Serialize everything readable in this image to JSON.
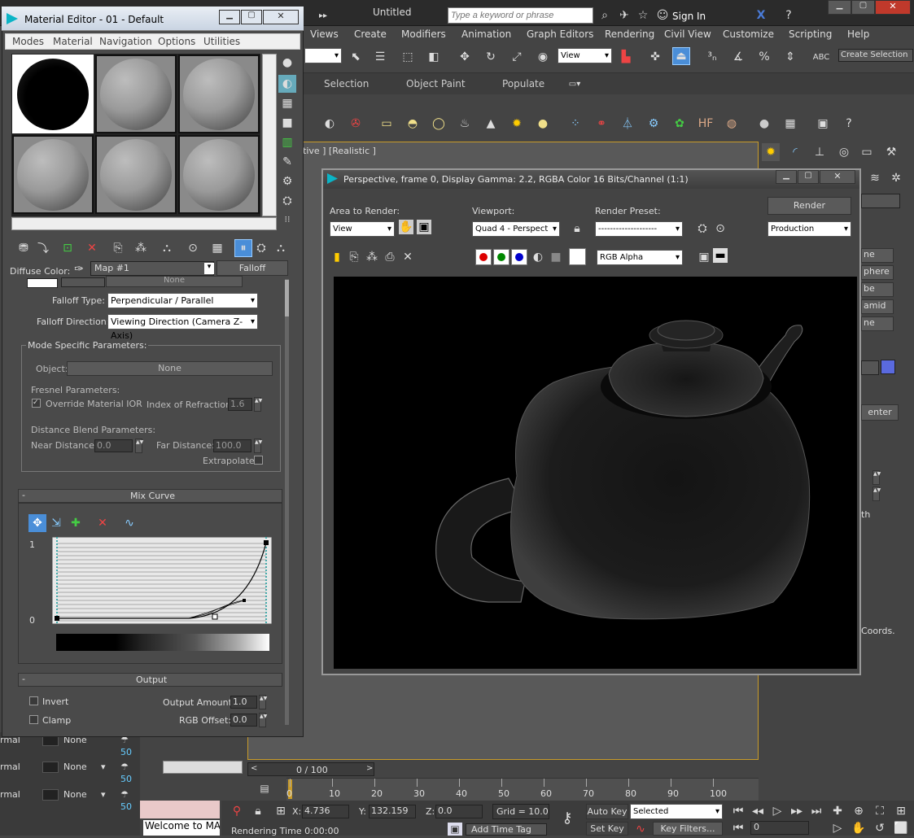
{
  "max": {
    "title": "Untitled",
    "search_placeholder": "Type a keyword or phrase",
    "sign_in": "Sign In",
    "menu": [
      "Views",
      "Create",
      "Modifiers",
      "Animation",
      "Graph Editors",
      "Rendering",
      "Civil View",
      "Customize",
      "Scripting",
      "Help"
    ],
    "view_dropdown": "View",
    "create_selection": "Create Selection",
    "ribbon_tabs": [
      "Selection",
      "Object Paint",
      "Populate"
    ],
    "viewport_label": "tive ] [Realistic ]",
    "cmd_buttons": [
      "ne",
      "phere",
      "be",
      "amid",
      "ne"
    ],
    "center_label": "enter",
    "th_label": "th",
    "coords_label": "Coords.",
    "timeline": {
      "frame": "0 / 100",
      "ticks": [
        "0",
        "10",
        "20",
        "30",
        "40",
        "50",
        "60",
        "70",
        "80",
        "90",
        "100"
      ]
    },
    "layer_rows": [
      {
        "label": "rmal",
        "value": "None",
        "num": "50"
      },
      {
        "label": "rmal",
        "value": "None",
        "num": "50"
      },
      {
        "label": "rmal",
        "value": "None",
        "num": "50"
      }
    ],
    "status": {
      "welcome": "Welcome to MA",
      "rendering_time": "Rendering Time 0:00:00",
      "add_time_tag": "Add Time Tag",
      "x_label": "X:",
      "x": "4.736",
      "y_label": "Y:",
      "y": "132.159",
      "z_label": "Z:",
      "z": "0.0",
      "grid": "Grid = 10.0",
      "auto_key": "Auto Key",
      "set_key": "Set Key",
      "selected": "Selected",
      "key_filters": "Key Filters...",
      "frame_field": "0"
    }
  },
  "mat": {
    "title": "Material Editor - 01 - Default",
    "menu": [
      "Modes",
      "Material",
      "Navigation",
      "Options",
      "Utilities"
    ],
    "diffuse_label": "Diffuse Color:",
    "map_name": "Map #1",
    "map_type": "Falloff",
    "top_partial": "None",
    "falloff_type_label": "Falloff Type:",
    "falloff_type": "Perpendicular / Parallel",
    "falloff_dir_label": "Falloff Direction:",
    "falloff_dir": "Viewing Direction (Camera Z-Axis)",
    "mode_params": "Mode Specific Parameters:",
    "object_label": "Object:",
    "object_value": "None",
    "fresnel_params": "Fresnel Parameters:",
    "override_ior": "Override Material IOR",
    "ior_label": "Index of Refraction",
    "ior": "1.6",
    "distance_params": "Distance Blend Parameters:",
    "near_label": "Near Distance:",
    "near": "0.0",
    "far_label": "Far Distance:",
    "far": "100.0",
    "extrapolate": "Extrapolate",
    "mix_curve": "Mix Curve",
    "curve_1": "1",
    "curve_0": "0",
    "output": "Output",
    "invert": "Invert",
    "clamp": "Clamp",
    "output_amount_label": "Output Amount:",
    "output_amount": "1.0",
    "rgb_offset_label": "RGB Offset:",
    "rgb_offset": "0.0",
    "collapse": "-"
  },
  "render": {
    "title": "Perspective, frame 0, Display Gamma: 2.2, RGBA Color 16 Bits/Channel (1:1)",
    "area_label": "Area to Render:",
    "area": "View",
    "viewport_label": "Viewport:",
    "viewport": "Quad 4 - Perspect",
    "preset_label": "Render Preset:",
    "preset": "--------------------",
    "render_btn": "Render",
    "production": "Production",
    "channel": "RGB Alpha"
  }
}
